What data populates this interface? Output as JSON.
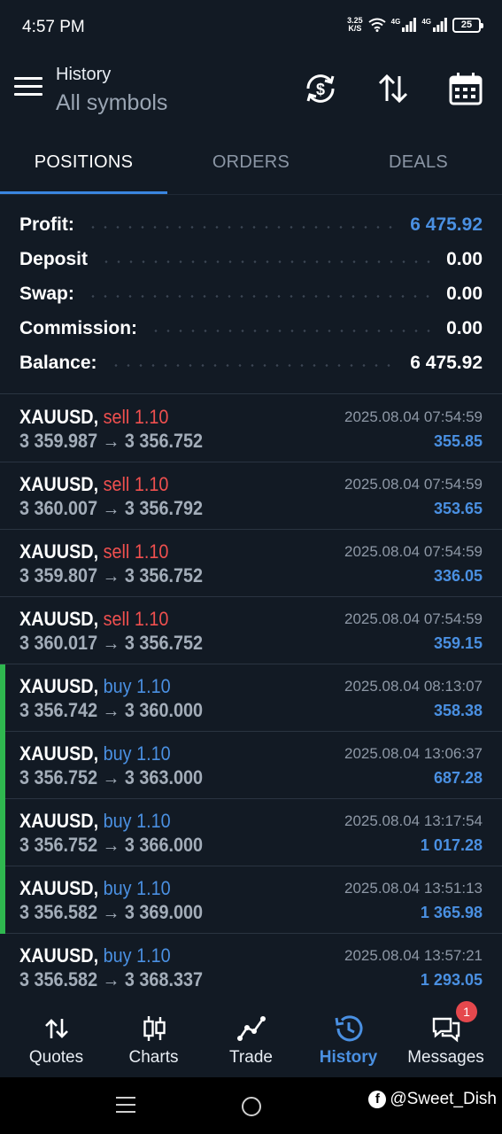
{
  "status_bar": {
    "time": "4:57 PM",
    "speed_value": "3.25",
    "speed_unit": "K/S",
    "net1": "4G",
    "net2": "4G",
    "battery": "25"
  },
  "header": {
    "title": "History",
    "subtitle": "All symbols"
  },
  "tabs": [
    {
      "label": "POSITIONS",
      "active": true
    },
    {
      "label": "ORDERS",
      "active": false
    },
    {
      "label": "DEALS",
      "active": false
    }
  ],
  "summary": [
    {
      "label": "Profit:",
      "value": "6 475.92",
      "highlight": true
    },
    {
      "label": "Deposit",
      "value": "0.00",
      "highlight": false
    },
    {
      "label": "Swap:",
      "value": "0.00",
      "highlight": false
    },
    {
      "label": "Commission:",
      "value": "0.00",
      "highlight": false
    },
    {
      "label": "Balance:",
      "value": "6 475.92",
      "highlight": false
    }
  ],
  "positions": [
    {
      "symbol": "XAUUSD,",
      "side": "sell",
      "volume": "1.10",
      "open_price": "3 359.987",
      "arrow": "→",
      "close_price": "3 356.752",
      "time": "2025.08.04 07:54:59",
      "profit": "355.85"
    },
    {
      "symbol": "XAUUSD,",
      "side": "sell",
      "volume": "1.10",
      "open_price": "3 360.007",
      "arrow": "→",
      "close_price": "3 356.792",
      "time": "2025.08.04 07:54:59",
      "profit": "353.65"
    },
    {
      "symbol": "XAUUSD,",
      "side": "sell",
      "volume": "1.10",
      "open_price": "3 359.807",
      "arrow": "→",
      "close_price": "3 356.752",
      "time": "2025.08.04 07:54:59",
      "profit": "336.05"
    },
    {
      "symbol": "XAUUSD,",
      "side": "sell",
      "volume": "1.10",
      "open_price": "3 360.017",
      "arrow": "→",
      "close_price": "3 356.752",
      "time": "2025.08.04 07:54:59",
      "profit": "359.15"
    },
    {
      "symbol": "XAUUSD,",
      "side": "buy",
      "volume": "1.10",
      "open_price": "3 356.742",
      "arrow": "→",
      "close_price": "3 360.000",
      "time": "2025.08.04 08:13:07",
      "profit": "358.38"
    },
    {
      "symbol": "XAUUSD,",
      "side": "buy",
      "volume": "1.10",
      "open_price": "3 356.752",
      "arrow": "→",
      "close_price": "3 363.000",
      "time": "2025.08.04 13:06:37",
      "profit": "687.28"
    },
    {
      "symbol": "XAUUSD,",
      "side": "buy",
      "volume": "1.10",
      "open_price": "3 356.752",
      "arrow": "→",
      "close_price": "3 366.000",
      "time": "2025.08.04 13:17:54",
      "profit": "1 017.28"
    },
    {
      "symbol": "XAUUSD,",
      "side": "buy",
      "volume": "1.10",
      "open_price": "3 356.582",
      "arrow": "→",
      "close_price": "3 369.000",
      "time": "2025.08.04 13:51:13",
      "profit": "1 365.98"
    },
    {
      "symbol": "XAUUSD,",
      "side": "buy",
      "volume": "1.10",
      "open_price": "3 356.582",
      "arrow": "→",
      "close_price": "3 368.337",
      "time": "2025.08.04 13:57:21",
      "profit": "1 293.05"
    }
  ],
  "bottom_nav": [
    {
      "label": "Quotes",
      "icon": "quotes-icon",
      "active": false
    },
    {
      "label": "Charts",
      "icon": "charts-icon",
      "active": false
    },
    {
      "label": "Trade",
      "icon": "trade-icon",
      "active": false
    },
    {
      "label": "History",
      "icon": "history-icon",
      "active": true
    },
    {
      "label": "Messages",
      "icon": "messages-icon",
      "active": false,
      "badge": "1"
    }
  ],
  "watermark": "@Sweet_Dish",
  "colors": {
    "background": "#121a24",
    "accent_blue": "#4a90e2",
    "sell_red": "#f0504f",
    "buy_green_accent": "#2fb84f"
  }
}
